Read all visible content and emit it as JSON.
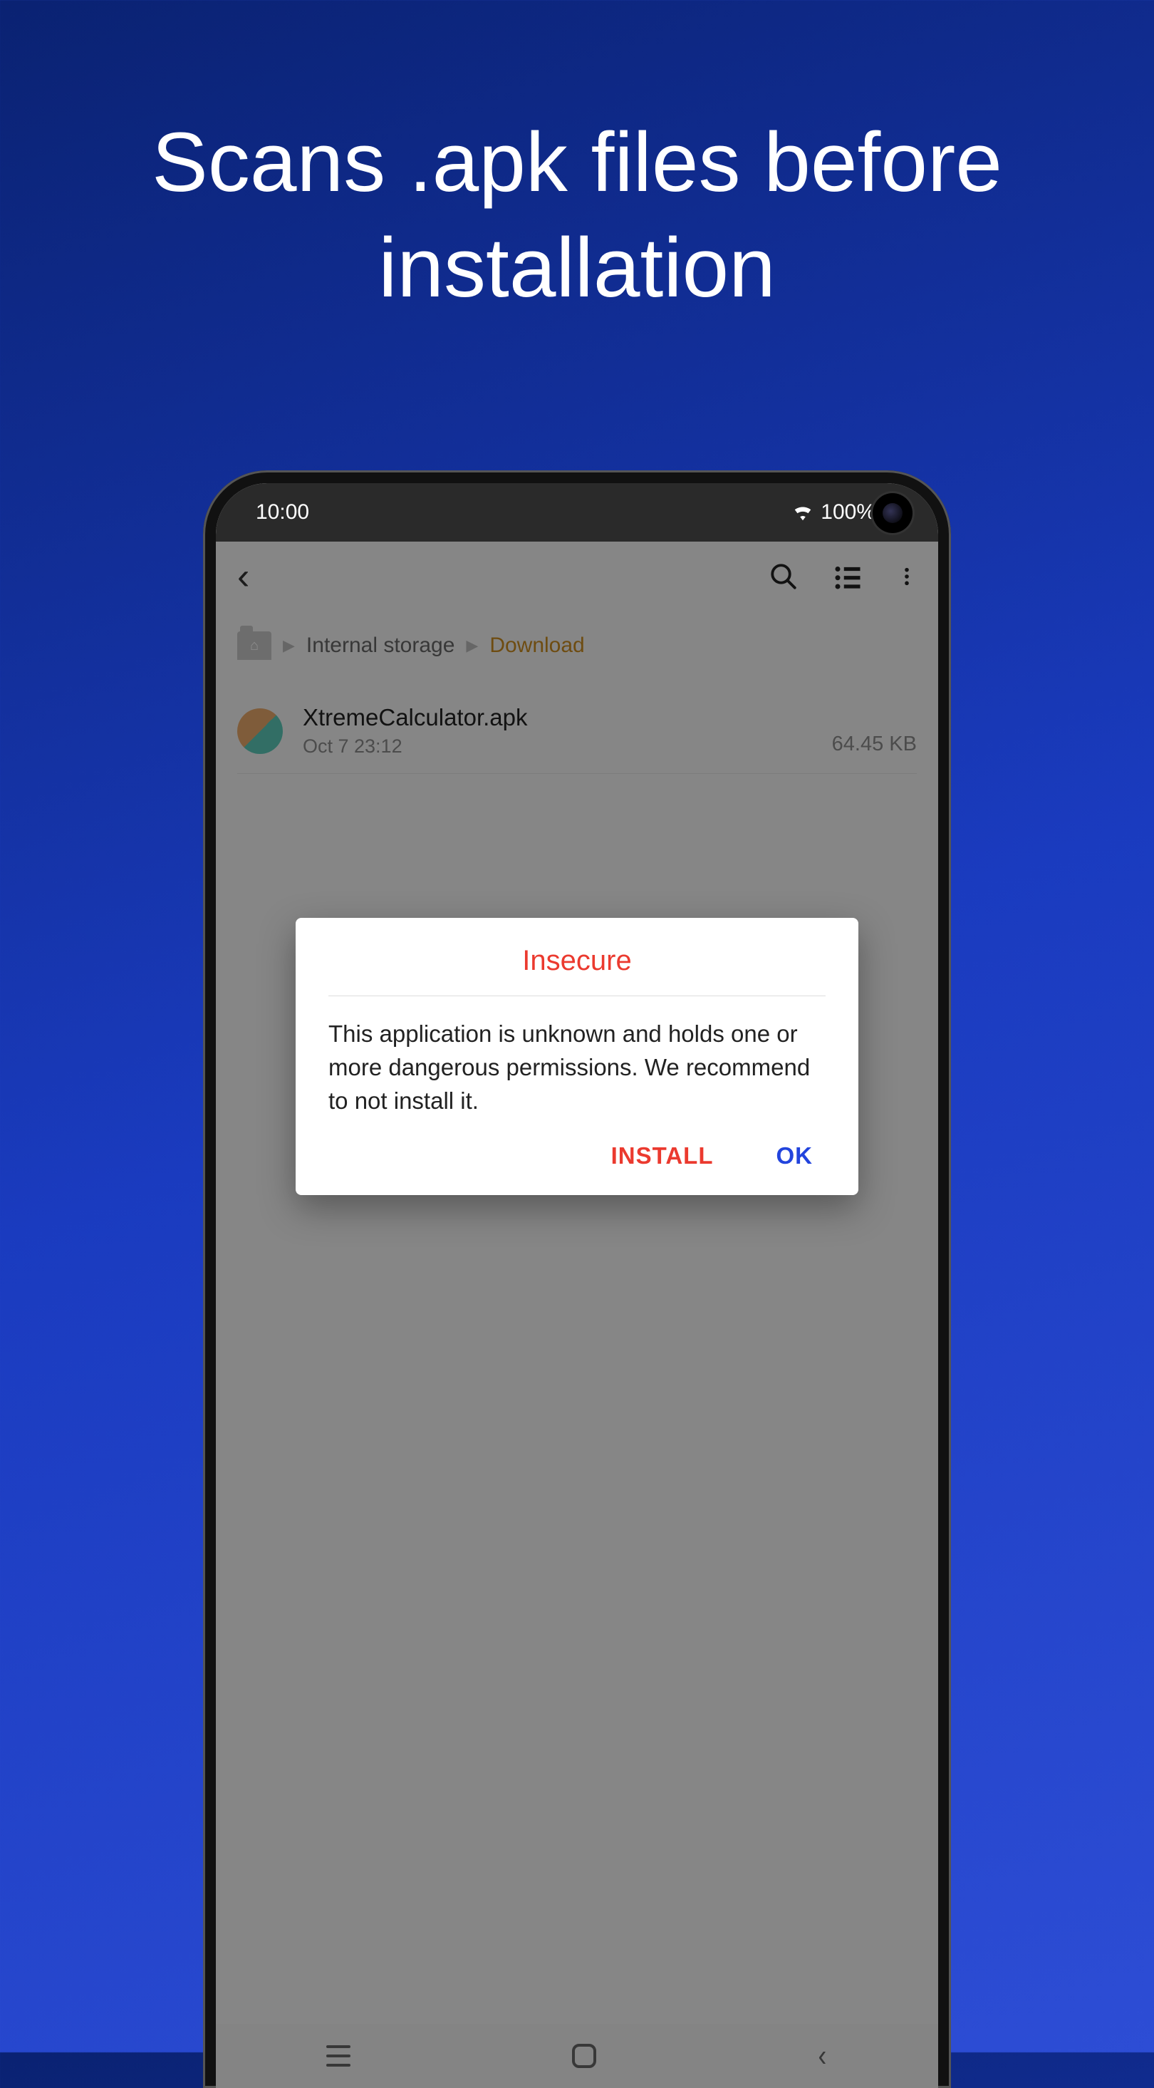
{
  "promo": {
    "headline": "Scans .apk files before installation"
  },
  "statusbar": {
    "time": "10:00",
    "battery": "100%"
  },
  "breadcrumb": {
    "root": "Internal storage",
    "current": "Download"
  },
  "file": {
    "name": "XtremeCalculator.apk",
    "date": "Oct 7 23:12",
    "size": "64.45 KB"
  },
  "dialog": {
    "title": "Insecure",
    "body": "This application is unknown and holds one or more dangerous permissions. We recommend to not install it.",
    "install_label": "INSTALL",
    "ok_label": "OK"
  }
}
